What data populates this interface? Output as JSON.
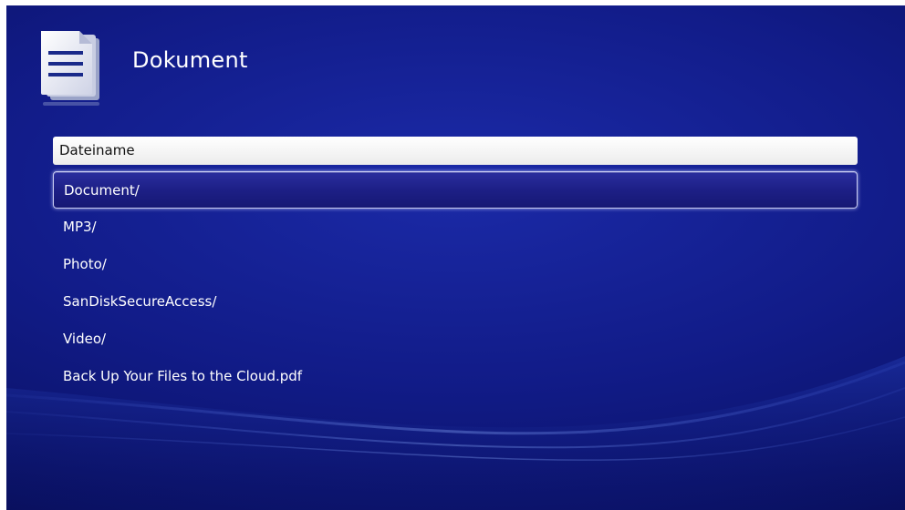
{
  "header": {
    "title": "Dokument",
    "icon": "document-icon"
  },
  "list": {
    "column_header": "Dateiname",
    "selected_index": 0,
    "items": [
      {
        "label": "Document/"
      },
      {
        "label": "MP3/"
      },
      {
        "label": "Photo/"
      },
      {
        "label": "SanDiskSecureAccess/"
      },
      {
        "label": "Video/"
      },
      {
        "label": "Back Up Your Files to the Cloud.pdf"
      }
    ]
  },
  "colors": {
    "background": "#111b87",
    "selection": "#1d1f86",
    "text": "#ffffff"
  }
}
